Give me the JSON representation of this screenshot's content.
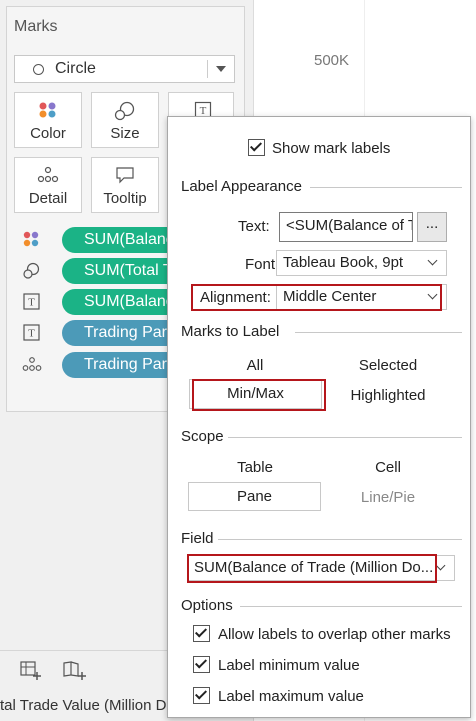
{
  "marks": {
    "title": "Marks",
    "mark_type": "Circle",
    "buttons": {
      "color": "Color",
      "size": "Size",
      "detail": "Detail",
      "tooltip": "Tooltip"
    },
    "pills": [
      {
        "label": "SUM(Balance of Trade (Million Dollars))",
        "color": "#1bb386",
        "icon": "color-icon"
      },
      {
        "label": "SUM(Total Trade Value (Million Dollars))",
        "color": "#1bb386",
        "icon": "size-icon"
      },
      {
        "label": "SUM(Balance of Trade (Million Dollars))",
        "color": "#1bb386",
        "icon": "text-label-icon"
      },
      {
        "label": "Trading Partner",
        "color": "#4c9ab8",
        "icon": "text-label-icon"
      },
      {
        "label": "Trading Partner",
        "color": "#4c9ab8",
        "icon": "detail-icon"
      }
    ]
  },
  "bottom": {
    "axis_title": "tal Trade Value (Million D"
  },
  "chart": {
    "axis_tick": "500K"
  },
  "label_dialog": {
    "show_mark_labels": {
      "label": "Show mark labels",
      "checked": true
    },
    "label_appearance": {
      "header": "Label Appearance",
      "text_label": "Text:",
      "text_value": "<SUM(Balance of Trade (Million Dollars))>",
      "more_button": "...",
      "font_label": "Font:",
      "font_value": "Tableau Book, 9pt",
      "alignment_label": "Alignment:",
      "alignment_value": "Middle Center"
    },
    "marks_to_label": {
      "header": "Marks to Label",
      "options": [
        "All",
        "Selected",
        "Min/Max",
        "Highlighted"
      ],
      "selected": "Min/Max"
    },
    "scope": {
      "header": "Scope",
      "options": [
        "Table",
        "Cell",
        "Pane",
        "Line/Pie"
      ],
      "selected": "Pane"
    },
    "field": {
      "header": "Field",
      "value": "SUM(Balance of Trade (Million Do..."
    },
    "options": {
      "header": "Options",
      "items": [
        {
          "label": "Allow labels to overlap other marks",
          "checked": true
        },
        {
          "label": "Label minimum value",
          "checked": true
        },
        {
          "label": "Label maximum value",
          "checked": true
        }
      ]
    },
    "highlight_color": "#b5161b"
  }
}
